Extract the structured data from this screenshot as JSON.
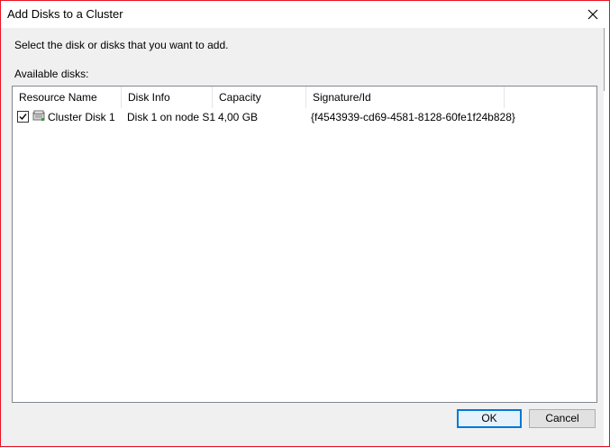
{
  "window": {
    "title": "Add Disks to a Cluster"
  },
  "instruction": "Select the disk or disks that you want to add.",
  "available_label": "Available disks:",
  "table": {
    "columns": [
      "Resource Name",
      "Disk Info",
      "Capacity",
      "Signature/Id"
    ],
    "rows": [
      {
        "checked": true,
        "icon": "cluster-disk-icon",
        "resource_name": "Cluster Disk 1",
        "disk_info": "Disk 1 on node S1",
        "capacity": "4,00 GB",
        "signature": "{f4543939-cd69-4581-8128-60fe1f24b828}"
      }
    ]
  },
  "buttons": {
    "ok": "OK",
    "cancel": "Cancel"
  },
  "colors": {
    "border": "#e81123",
    "primary_accent": "#0078d7"
  }
}
